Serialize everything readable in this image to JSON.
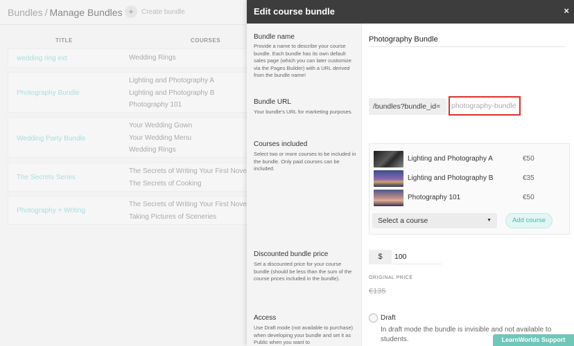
{
  "background": {
    "breadcrumb": {
      "root": "Bundles",
      "separator": "/",
      "current": "Manage Bundles"
    },
    "create_bundle": "Create bundle",
    "table_headers": {
      "title": "TITLE",
      "courses": "COURSES"
    },
    "rows": [
      {
        "title": "wedding ring ext",
        "courses": [
          "Wedding Rings"
        ]
      },
      {
        "title": "Photography Bundle",
        "courses": [
          "Lighting and Photography A",
          "Lighting and Photography B",
          "Photography 101"
        ]
      },
      {
        "title": "Wedding Party Bundle",
        "courses": [
          "Your Wedding Gown",
          "Your Wedding Menu",
          "Wedding Rings"
        ]
      },
      {
        "title": "The Secrets Series",
        "courses": [
          "The Secrets of Writing Your First Novel",
          "The Secrets of Cooking"
        ]
      },
      {
        "title": "Photography + Writing",
        "courses": [
          "The Secrets of Writing Your First Novel",
          "Taking Pictures of Sceneries"
        ]
      }
    ]
  },
  "modal": {
    "title": "Edit course bundle",
    "close": "×",
    "sections": {
      "name": {
        "title": "Bundle name",
        "description": "Provide a name to describe your course bundle. Each bundle has its own default sales page (which you can later customize via the Pages Builder) with a URL derived from the bundle name!",
        "value": "Photography Bundle"
      },
      "url": {
        "title": "Bundle URL",
        "description": "Your bundle's URL for marketing purposes.",
        "prefix": "/bundles?bundle_id=",
        "value": "photography-bundle"
      },
      "courses": {
        "title": "Courses included",
        "description": "Select two or more courses to be included in the bundle. Only paid courses can be included.",
        "items": [
          {
            "name": "Lighting and Photography A",
            "price": "€50"
          },
          {
            "name": "Lighting and Photography B",
            "price": "€35"
          },
          {
            "name": "Photography 101",
            "price": "€50"
          }
        ],
        "select_placeholder": "Select a course",
        "add_button": "Add course"
      },
      "price": {
        "title": "Discounted bundle price",
        "description": "Set a discounted price for your course bundle (should be less than the sum of the course prices included in the bundle).",
        "currency": "$",
        "value": "100",
        "original_label": "ORIGINAL PRICE",
        "original_value": "€135"
      },
      "access": {
        "title": "Access",
        "description": "Use Draft mode (not available to purchase) when developing your bundle and set it as Public when you want to",
        "option_label": "Draft",
        "option_description": "In draft mode the bundle is invisible and not available to students."
      }
    }
  },
  "support_button": "LearnWorlds Support",
  "colors": {
    "accent": "#3fb8ad",
    "header": "#3d3d3d",
    "highlight": "#d9302b"
  }
}
